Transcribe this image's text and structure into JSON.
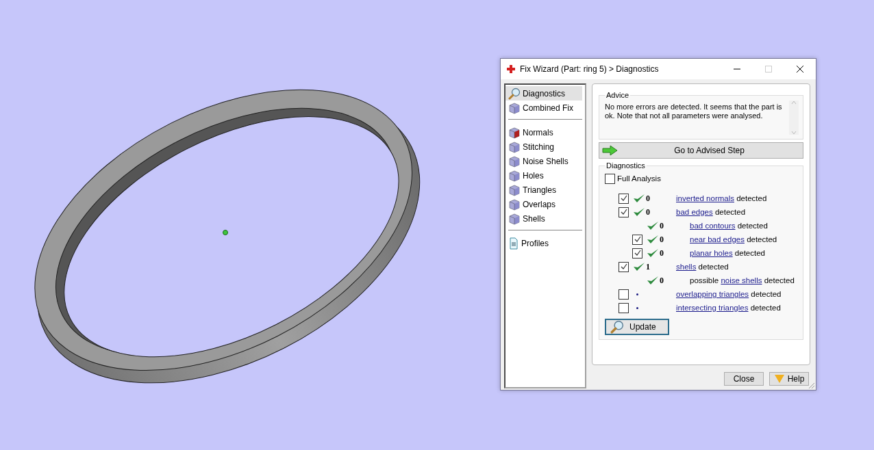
{
  "window": {
    "title": "Fix Wizard (Part: ring 5) > Diagnostics"
  },
  "sidebar": {
    "groups": [
      [
        {
          "label": "Diagnostics",
          "selected": true
        },
        {
          "label": "Combined Fix",
          "selected": false
        }
      ],
      [
        {
          "label": "Normals",
          "selected": false
        },
        {
          "label": "Stitching",
          "selected": false
        },
        {
          "label": "Noise Shells",
          "selected": false
        },
        {
          "label": "Holes",
          "selected": false
        },
        {
          "label": "Triangles",
          "selected": false
        },
        {
          "label": "Overlaps",
          "selected": false
        },
        {
          "label": "Shells",
          "selected": false
        }
      ],
      [
        {
          "label": "Profiles",
          "selected": false
        }
      ]
    ]
  },
  "advice": {
    "title": "Advice",
    "text": "No more errors are detected. It seems that the part is ok. Note that not all parameters were analysed."
  },
  "advised_button": "Go to Advised Step",
  "diagnostics": {
    "title": "Diagnostics",
    "full_analysis": {
      "label": "Full Analysis",
      "checked": false
    },
    "rows": [
      {
        "kind": "checkbox",
        "checked": true,
        "passed": true,
        "count": "0",
        "link": "inverted normals",
        "suffix": " detected"
      },
      {
        "kind": "checkbox",
        "checked": true,
        "passed": true,
        "count": "0",
        "link": "bad edges",
        "suffix": " detected",
        "children": [
          {
            "kind": "plain",
            "passed": true,
            "count": "0",
            "link": "bad contours",
            "suffix": " detected"
          },
          {
            "kind": "checkbox",
            "checked": true,
            "passed": true,
            "count": "0",
            "link": "near bad edges",
            "suffix": " detected"
          },
          {
            "kind": "checkbox",
            "checked": true,
            "passed": true,
            "count": "0",
            "link": "planar holes",
            "suffix": " detected"
          }
        ]
      },
      {
        "kind": "checkbox",
        "checked": true,
        "passed": true,
        "count": "1",
        "link": "shells",
        "suffix": " detected",
        "children": [
          {
            "kind": "plain",
            "passed": true,
            "count": "0",
            "prefix": "possible ",
            "link": "noise shells",
            "suffix": " detected"
          }
        ]
      },
      {
        "kind": "checkbox",
        "checked": false,
        "passed": false,
        "link": "overlapping triangles",
        "suffix": " detected"
      },
      {
        "kind": "checkbox",
        "checked": false,
        "passed": false,
        "link": "intersecting triangles",
        "suffix": " detected"
      }
    ],
    "update_button": "Update"
  },
  "buttons": [
    "Close",
    "Help"
  ]
}
